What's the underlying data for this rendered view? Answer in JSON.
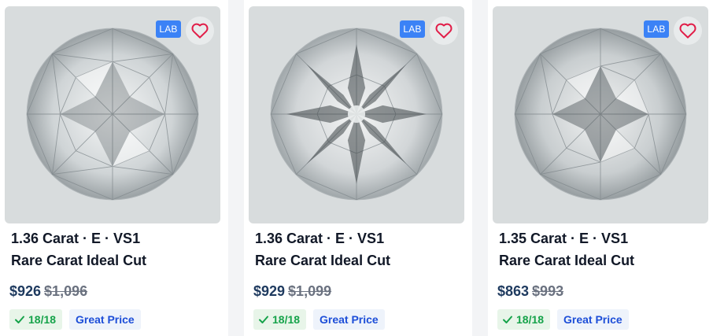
{
  "products": [
    {
      "badge": "LAB",
      "title_line1": "1.36 Carat · E · VS1",
      "title_line2": "Rare Carat Ideal Cut",
      "price": "$926",
      "old_price": "$1,096",
      "score": "18/18",
      "tag": "Great Price"
    },
    {
      "badge": "LAB",
      "title_line1": "1.36 Carat · E · VS1",
      "title_line2": "Rare Carat Ideal Cut",
      "price": "$929",
      "old_price": "$1,099",
      "score": "18/18",
      "tag": "Great Price"
    },
    {
      "badge": "LAB",
      "title_line1": "1.35 Carat · E · VS1",
      "title_line2": "Rare Carat Ideal Cut",
      "price": "$863",
      "old_price": "$993",
      "score": "18/18",
      "tag": "Great Price"
    }
  ],
  "icons": {
    "favorite": "heart-outline-icon",
    "score": "check-icon",
    "diamond": "round-brilliant-diamond"
  },
  "colors": {
    "lab_badge": "#3b82f6",
    "heart": "#e11d48",
    "score_green": "#16a34a",
    "great_price_blue": "#1d4ed8",
    "price_navy": "#1e3a5f"
  }
}
